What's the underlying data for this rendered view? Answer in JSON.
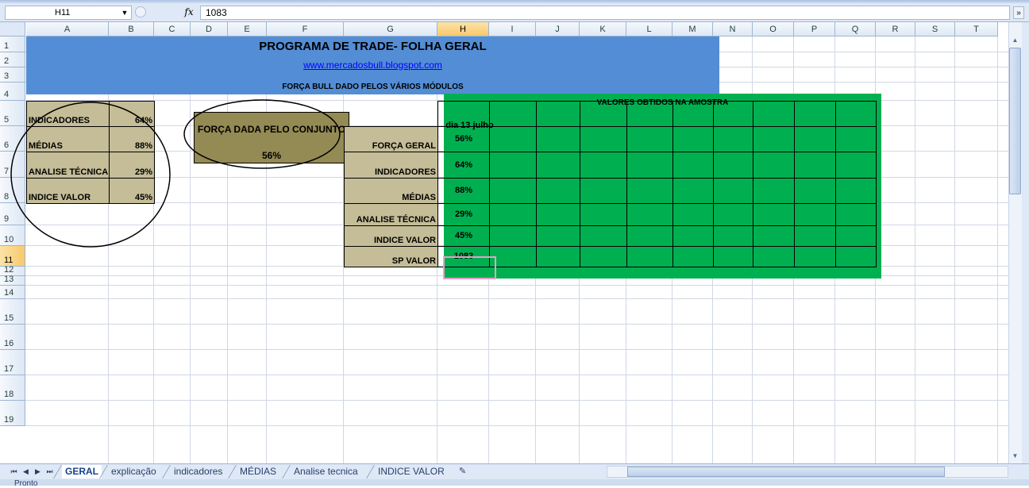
{
  "formula_bar": {
    "name_box": "H11",
    "fx": "fx",
    "value": "1083"
  },
  "columns": [
    "A",
    "B",
    "C",
    "D",
    "E",
    "F",
    "G",
    "H",
    "I",
    "J",
    "K",
    "L",
    "M",
    "N",
    "O",
    "P",
    "Q",
    "R",
    "S",
    "T"
  ],
  "rows": [
    "1",
    "2",
    "3",
    "4",
    "5",
    "6",
    "7",
    "8",
    "9",
    "10",
    "11",
    "12",
    "13",
    "14",
    "15",
    "16",
    "17",
    "18",
    "19"
  ],
  "selected": {
    "column": "H",
    "row": "11"
  },
  "header": {
    "title": "PROGRAMA DE TRADE- FOLHA GERAL",
    "link": "www.mercadosbull.blogspot.com",
    "subtitle": "FORÇA BULL DADO PELOS VÁRIOS MÓDULOS"
  },
  "left_table": [
    {
      "label": "INDICADORES",
      "value": "64%"
    },
    {
      "label": "MÉDIAS",
      "value": "88%"
    },
    {
      "label": "ANALISE TÉCNICA",
      "value": "29%"
    },
    {
      "label": "INDICE VALOR",
      "value": "45%"
    }
  ],
  "forca_box": {
    "label": "FORÇA DADA PELO CONJUNTO",
    "value": "56%"
  },
  "sample": {
    "heading": "VALORES OBTIDOS NA AMOSTRA",
    "date_header": "dia 13 julho",
    "rows": [
      {
        "label": "FORÇA GERAL",
        "value": "56%"
      },
      {
        "label": "INDICADORES",
        "value": "64%"
      },
      {
        "label": "MÉDIAS",
        "value": "88%"
      },
      {
        "label": "ANALISE TÉCNICA",
        "value": "29%"
      },
      {
        "label": "INDICE VALOR",
        "value": "45%"
      },
      {
        "label": "SP VALOR",
        "value": "1083"
      }
    ]
  },
  "sheet_tabs": [
    {
      "label": "GERAL",
      "active": true
    },
    {
      "label": "explicação",
      "active": false
    },
    {
      "label": "indicadores",
      "active": false
    },
    {
      "label": "MÉDIAS",
      "active": false
    },
    {
      "label": "Analise tecnica",
      "active": false
    },
    {
      "label": "INDICE VALOR",
      "active": false
    }
  ],
  "status": "Pronto",
  "colors": {
    "header_blue": "#538dd5",
    "green": "#00b050",
    "tan": "#c4bd97",
    "olive": "#948a54",
    "selection": "#f8c96c"
  }
}
